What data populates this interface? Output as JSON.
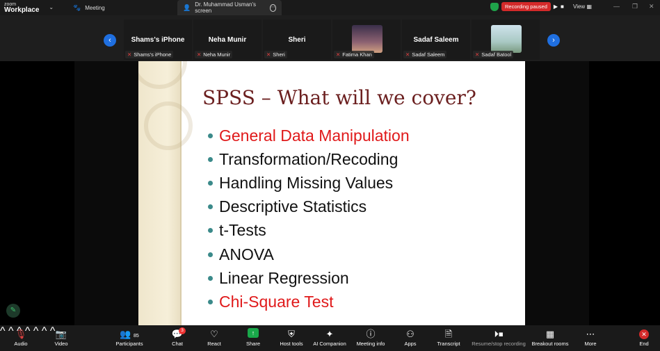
{
  "app": {
    "brand_top": "zoom",
    "brand_bottom": "Workplace"
  },
  "tabs": [
    {
      "label": "Meeting"
    },
    {
      "label": "Dr. Muhammad Usman's screen"
    }
  ],
  "recording": {
    "status": "Recording paused",
    "play": "▶",
    "stop": "■"
  },
  "view": {
    "label": "View"
  },
  "participants_strip": [
    {
      "display": "Shams's iPhone",
      "label": "Shams's iPhone"
    },
    {
      "display": "Neha Munir",
      "label": "Neha Munir"
    },
    {
      "display": "Sheri",
      "label": "Sheri"
    },
    {
      "display": "",
      "label": "Fatima Khan"
    },
    {
      "display": "Sadaf Saleem",
      "label": "Sadaf Saleem"
    },
    {
      "display": "",
      "label": "Sadaf Batool"
    }
  ],
  "slide": {
    "title": "SPSS – What will we cover?",
    "bullets": [
      {
        "text": "General Data Manipulation",
        "highlight": true
      },
      {
        "text": "Transformation/Recoding",
        "highlight": false
      },
      {
        "text": "Handling Missing Values",
        "highlight": false
      },
      {
        "text": "Descriptive Statistics",
        "highlight": false
      },
      {
        "text": "t-Tests",
        "highlight": false
      },
      {
        "text": "ANOVA",
        "highlight": false
      },
      {
        "text": "Linear Regression",
        "highlight": false
      },
      {
        "text": "Chi-Square Test",
        "highlight": true
      }
    ]
  },
  "toolbar": {
    "audio": "Audio",
    "video": "Video",
    "participants": "Participants",
    "participants_count": "85",
    "chat": "Chat",
    "chat_badge": "3",
    "react": "React",
    "share": "Share",
    "host_tools": "Host tools",
    "ai_companion": "AI Companion",
    "meeting_info": "Meeting info",
    "apps": "Apps",
    "transcript": "Transcript",
    "resume_stop": "Resume/stop recording",
    "breakout": "Breakout rooms",
    "more": "More",
    "end": "End"
  },
  "colors": {
    "accent_blue": "#1f6fe0",
    "share_green": "#19a84a",
    "recording_red": "#d42a2a",
    "slide_title": "#6b1f1f",
    "bullet_red": "#e0191a",
    "bullet_dot": "#3b8a8a"
  }
}
